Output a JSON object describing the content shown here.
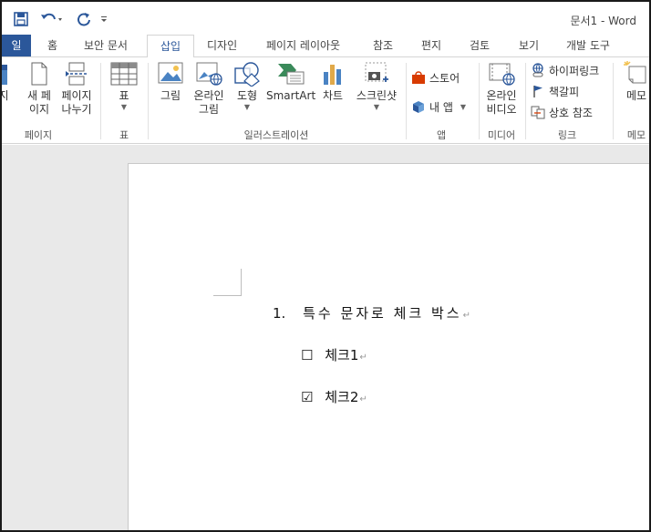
{
  "app": {
    "title": "문서1 - Word"
  },
  "colors": {
    "accent": "#2b579a",
    "ribbon_bg": "#ffffff",
    "doc_bg": "#e9e9e9"
  },
  "qat": [
    {
      "name": "save-icon"
    },
    {
      "name": "undo-icon"
    },
    {
      "name": "redo-icon"
    },
    {
      "name": "customize-qat-icon"
    }
  ],
  "tabs": [
    "일",
    "홈",
    "보안 문서",
    "삽입",
    "디자인",
    "페이지 레이아웃",
    "참조",
    "편지",
    "검토",
    "보기",
    "개발 도구"
  ],
  "ribbon": {
    "pages": {
      "label": "페이지",
      "cover": "지",
      "blank_1": "새 페",
      "blank_2": "이지",
      "break_1": "페이지",
      "break_2": "나누기"
    },
    "table": {
      "label": "표",
      "button": "표"
    },
    "illustrations": {
      "label": "일러스트레이션",
      "picture_1": "그림",
      "online_1": "온라인",
      "online_2": "그림",
      "shapes": "도형",
      "smartart": "SmartArt",
      "chart": "차트",
      "screenshot": "스크린샷"
    },
    "apps": {
      "label": "앱",
      "store": "스토어",
      "myapps": "내 앱"
    },
    "media": {
      "label": "미디어",
      "video_1": "온라인",
      "video_2": "비디오"
    },
    "links": {
      "label": "링크",
      "hyperlink": "하이퍼링크",
      "bookmark": "책갈피",
      "crossref": "상호 참조"
    },
    "comments": {
      "label": "메모",
      "button": "메모"
    }
  },
  "document": {
    "lines": [
      {
        "number": "1.",
        "text": "특수 문자로 체크 박스"
      },
      {
        "symbol": "☐",
        "text": "체크1"
      },
      {
        "symbol": "☑",
        "text": "체크2"
      }
    ],
    "para_mark": "↵"
  }
}
